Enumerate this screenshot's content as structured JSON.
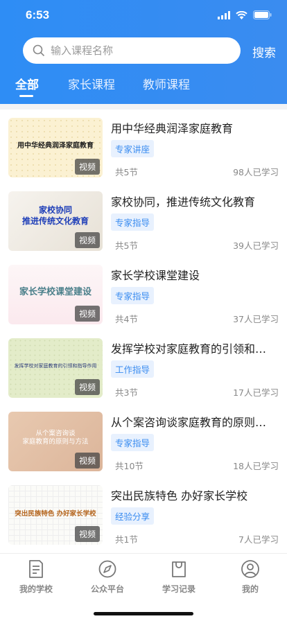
{
  "status_bar": {
    "time": "6:53"
  },
  "search": {
    "placeholder": "输入课程名称",
    "button_label": "搜索"
  },
  "tabs": [
    {
      "label": "全部",
      "active": true
    },
    {
      "label": "家长课程",
      "active": false
    },
    {
      "label": "教师课程",
      "active": false
    }
  ],
  "courses": [
    {
      "title": "用中华经典润泽家庭教育",
      "thumb_text": "用中华经典润泽家庭教育",
      "badge": "视频",
      "tag": "专家讲座",
      "lessons": "共5节",
      "learners": "98人已学习"
    },
    {
      "title": "家校协同，推进传统文化教育",
      "thumb_text": "家校协同\n推进传统文化教育",
      "badge": "视频",
      "tag": "专家指导",
      "lessons": "共5节",
      "learners": "39人已学习"
    },
    {
      "title": "家长学校课堂建设",
      "thumb_text": "家长学校课堂建设",
      "badge": "视频",
      "tag": "专家指导",
      "lessons": "共4节",
      "learners": "37人已学习"
    },
    {
      "title": "发挥学校对家庭教育的引领和指导作用",
      "thumb_text": "发挥学校对家庭教育的引领和指导作用",
      "badge": "视频",
      "tag": "工作指导",
      "lessons": "共3节",
      "learners": "17人已学习"
    },
    {
      "title": "从个案咨询谈家庭教育的原则与方法",
      "thumb_text": "从个案咨询谈\n家庭教育的原则与方法",
      "badge": "视频",
      "tag": "专家指导",
      "lessons": "共10节",
      "learners": "18人已学习"
    },
    {
      "title": "突出民族特色 办好家长学校",
      "thumb_text": "突出民族特色 办好家长学校",
      "badge": "视频",
      "tag": "经验分享",
      "lessons": "共1节",
      "learners": "7人已学习"
    }
  ],
  "tabbar": [
    {
      "label": "我的学校",
      "icon": "document-icon"
    },
    {
      "label": "公众平台",
      "icon": "compass-icon"
    },
    {
      "label": "学习记录",
      "icon": "bag-icon"
    },
    {
      "label": "我的",
      "icon": "user-icon"
    }
  ],
  "colors": {
    "brand": "#3a8cf0",
    "tag_bg": "#e8f1fe"
  }
}
